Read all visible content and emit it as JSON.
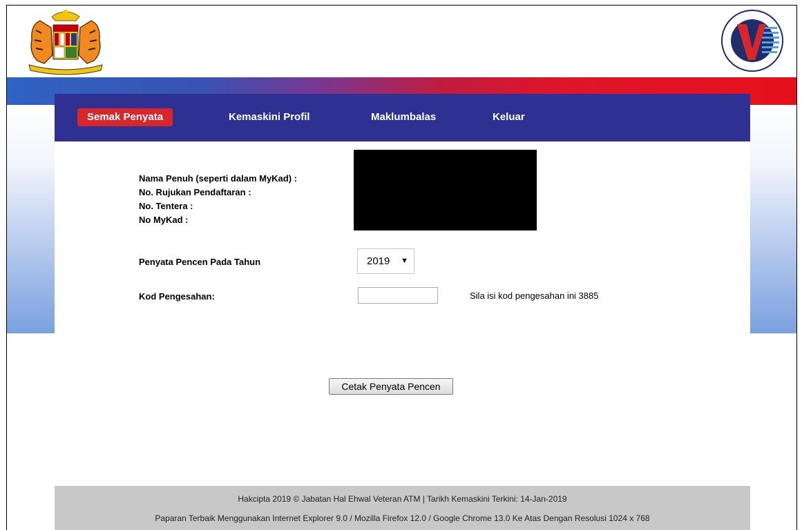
{
  "header": {
    "crest_logo": {
      "icon": "malaysia-coat-of-arms-icon",
      "motto": "BERSEKUTU BERTAMBAH MUTU"
    },
    "agency_logo": {
      "icon": "veteran-v-logo-icon",
      "ring_text": "JABATAN HAL EHWAL VETERAN ANGKATAN TENTERA MALAYSIA",
      "letter": "V"
    }
  },
  "nav": {
    "items": [
      {
        "label": "Semak Penyata",
        "active": true
      },
      {
        "label": "Kemaskini Profil",
        "active": false
      },
      {
        "label": "Maklumbalas",
        "active": false
      },
      {
        "label": "Keluar",
        "active": false
      }
    ]
  },
  "profile": {
    "labels": [
      "Nama Penuh (seperti dalam MyKad) :",
      "No. Rujukan Pendaftaran :",
      "No. Tentera :",
      "No MyKad :"
    ]
  },
  "form": {
    "year_label": "Penyata Pencen Pada Tahun",
    "year_value": "2019",
    "year_arrow": "▼",
    "code_label": "Kod Pengesahan:",
    "code_value": "",
    "code_hint": "Sila isi kod pengesahan ini 3885",
    "print_button": "Cetak Penyata Pencen"
  },
  "footer": {
    "line1": "Hakcipta 2019 © Jabatan Hal Ehwal Veteran ATM | Tarikh Kemaskini Terkini: 14-Jan-2019",
    "line2": "Paparan Terbaik Menggunakan Internet Explorer 9.0 / Mozilla Firefox 12.0 / Google Chrome 13.0 Ke Atas Dengan Resolusi 1024 x 768"
  },
  "colors": {
    "nav_bg": "#2e3192",
    "nav_active": "#d8262d",
    "footer_bg": "#c8c8c8"
  }
}
